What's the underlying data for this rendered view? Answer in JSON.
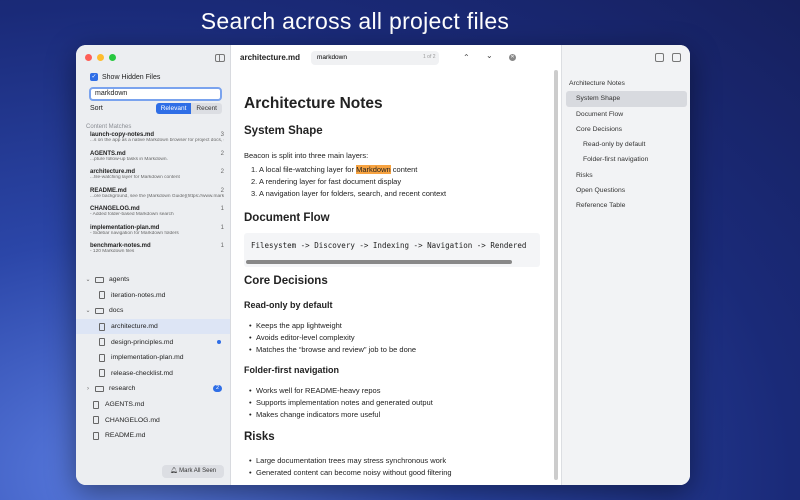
{
  "headline": "Search across all project files",
  "colors": {
    "accent": "#2f6ee6",
    "highlight": "#f7a341",
    "traffic_red": "#fe5f57",
    "traffic_yellow": "#febc2e",
    "traffic_green": "#28c840"
  },
  "sidebar": {
    "show_hidden_label": "Show Hidden Files",
    "show_hidden_checked": true,
    "search_value": "markdown",
    "sort_label": "Sort",
    "sort_options": [
      "Relevant",
      "Recent"
    ],
    "sort_selected": "Relevant",
    "content_matches_label": "Content Matches",
    "matches": [
      {
        "name": "launch-copy-notes.md",
        "count": "3",
        "snippet": "...s on the app as a native Markdown browser for project docs, generated not..."
      },
      {
        "name": "AGENTS.md",
        "count": "2",
        "snippet": "...pture follow-up tasks in Markdown."
      },
      {
        "name": "architecture.md",
        "count": "2",
        "snippet": "...file-watching layer for Markdown content"
      },
      {
        "name": "README.md",
        "count": "2",
        "snippet": "...ore background, see the [Markdown Guide](https://www.markdownguide.org/ba..."
      },
      {
        "name": "CHANGELOG.md",
        "count": "1",
        "snippet": "- Added folder-based Markdown search"
      },
      {
        "name": "implementation-plan.md",
        "count": "1",
        "snippet": "- Sidebar navigation for Markdown folders"
      },
      {
        "name": "benchmark-notes.md",
        "count": "1",
        "snippet": "- 120 Markdown files"
      }
    ],
    "tree": [
      {
        "label": "agents",
        "kind": "folder",
        "indent": 0,
        "expanded": true
      },
      {
        "label": "iteration-notes.md",
        "kind": "file",
        "indent": 1
      },
      {
        "label": "docs",
        "kind": "folder",
        "indent": 0,
        "expanded": true
      },
      {
        "label": "architecture.md",
        "kind": "file",
        "indent": 1,
        "selected": true
      },
      {
        "label": "design-principles.md",
        "kind": "file",
        "indent": 1,
        "dot": true
      },
      {
        "label": "implementation-plan.md",
        "kind": "file",
        "indent": 1
      },
      {
        "label": "release-checklist.md",
        "kind": "file",
        "indent": 1
      },
      {
        "label": "research",
        "kind": "folder",
        "indent": 0,
        "expanded": false,
        "badge": "2"
      },
      {
        "label": "AGENTS.md",
        "kind": "file",
        "indent": 0
      },
      {
        "label": "CHANGELOG.md",
        "kind": "file",
        "indent": 0
      },
      {
        "label": "README.md",
        "kind": "file",
        "indent": 0
      }
    ],
    "mark_all_seen": "Mark All Seen"
  },
  "main": {
    "doc_title": "architecture.md",
    "find_value": "markdown",
    "find_count": "1 of 2",
    "h1": "Architecture Notes",
    "system_shape": "System Shape",
    "intro": "Beacon is split into three main layers:",
    "layers": [
      {
        "pre": "A local file-watching layer for ",
        "hl": "Markdown",
        "post": " content"
      },
      {
        "pre": "A rendering layer for fast document display",
        "hl": "",
        "post": ""
      },
      {
        "pre": "A navigation layer for folders, search, and recent context",
        "hl": "",
        "post": ""
      }
    ],
    "doc_flow": "Document Flow",
    "code": "Filesystem -> Discovery -> Indexing -> Navigation -> Rendered",
    "core_decisions": "Core Decisions",
    "readonly_h": "Read-only by default",
    "readonly_items": [
      "Keeps the app lightweight",
      "Avoids editor-level complexity",
      "Matches the “browse and review” job to be done"
    ],
    "folder_h": "Folder-first navigation",
    "folder_items": [
      "Works well for README-heavy repos",
      "Supports implementation notes and generated output",
      "Makes change indicators more useful"
    ],
    "risks": "Risks",
    "risk_items": [
      "Large documentation trees may stress synchronous work",
      "Generated content can become noisy without good filtering"
    ]
  },
  "outline": {
    "items": [
      {
        "label": "Architecture Notes",
        "indent": 0
      },
      {
        "label": "System Shape",
        "indent": 1,
        "active": true
      },
      {
        "label": "Document Flow",
        "indent": 1
      },
      {
        "label": "Core Decisions",
        "indent": 1
      },
      {
        "label": "Read-only by default",
        "indent": 2
      },
      {
        "label": "Folder-first navigation",
        "indent": 2
      },
      {
        "label": "Risks",
        "indent": 1
      },
      {
        "label": "Open Questions",
        "indent": 1
      },
      {
        "label": "Reference Table",
        "indent": 1
      }
    ]
  }
}
